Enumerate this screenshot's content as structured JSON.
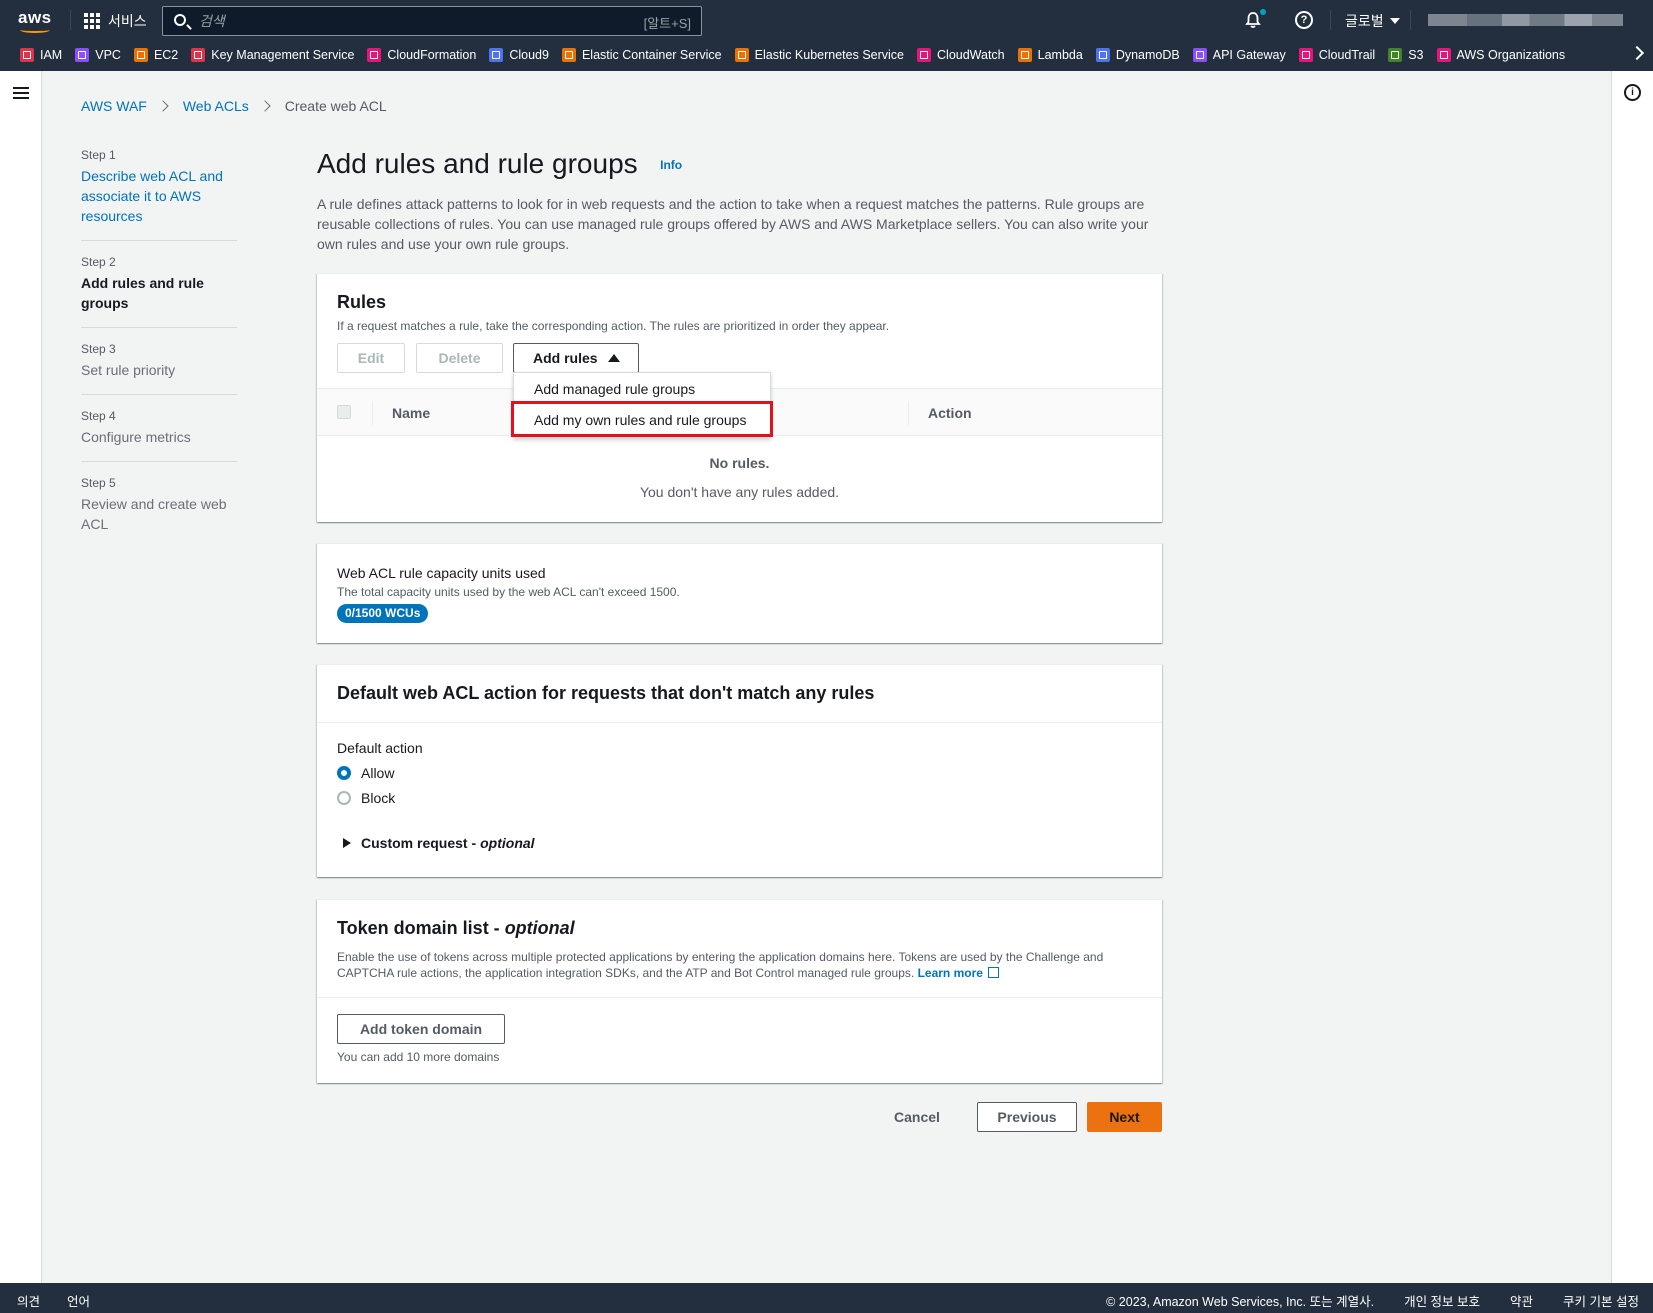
{
  "topnav": {
    "logo_text": "aws",
    "services_label": "서비스",
    "search_placeholder": "검색",
    "search_shortcut": "[알트+S]",
    "help_symbol": "?",
    "region_label": "글로벌",
    "favorites": [
      {
        "label": "IAM",
        "color": "#dd344c"
      },
      {
        "label": "VPC",
        "color": "#8c4fff"
      },
      {
        "label": "EC2",
        "color": "#ed7100"
      },
      {
        "label": "Key Management Service",
        "color": "#dd344c"
      },
      {
        "label": "CloudFormation",
        "color": "#e7157b"
      },
      {
        "label": "Cloud9",
        "color": "#4d72f3"
      },
      {
        "label": "Elastic Container Service",
        "color": "#ed7100"
      },
      {
        "label": "Elastic Kubernetes Service",
        "color": "#ed7100"
      },
      {
        "label": "CloudWatch",
        "color": "#e7157b"
      },
      {
        "label": "Lambda",
        "color": "#ed7100"
      },
      {
        "label": "DynamoDB",
        "color": "#4d72f3"
      },
      {
        "label": "API Gateway",
        "color": "#8c4fff"
      },
      {
        "label": "CloudTrail",
        "color": "#e7157b"
      },
      {
        "label": "S3",
        "color": "#3f8624"
      },
      {
        "label": "AWS Organizations",
        "color": "#e7157b"
      }
    ]
  },
  "right_rail": {
    "info_symbol": "i"
  },
  "breadcrumb": {
    "items": [
      "AWS WAF",
      "Web ACLs"
    ],
    "current": "Create web ACL"
  },
  "steps": [
    {
      "num": "Step 1",
      "title": "Describe web ACL and associate it to AWS resources",
      "state": "link"
    },
    {
      "num": "Step 2",
      "title": "Add rules and rule groups",
      "state": "active"
    },
    {
      "num": "Step 3",
      "title": "Set rule priority",
      "state": "disabled"
    },
    {
      "num": "Step 4",
      "title": "Configure metrics",
      "state": "disabled"
    },
    {
      "num": "Step 5",
      "title": "Review and create web ACL",
      "state": "disabled"
    }
  ],
  "main": {
    "title": "Add rules and rule groups",
    "info_link": "Info",
    "description": "A rule defines attack patterns to look for in web requests and the action to take when a request matches the patterns. Rule groups are reusable collections of rules. You can use managed rule groups offered by AWS and AWS Marketplace sellers. You can also write your own rules and use your own rule groups."
  },
  "rules": {
    "title": "Rules",
    "subtitle": "If a request matches a rule, take the corresponding action. The rules are prioritized in order they appear.",
    "edit_label": "Edit",
    "delete_label": "Delete",
    "add_rules_label": "Add rules",
    "col_name": "Name",
    "col_action": "Action",
    "empty_title": "No rules.",
    "empty_sub": "You don't have any rules added.",
    "dropdown": [
      "Add managed rule groups",
      "Add my own rules and rule groups"
    ]
  },
  "wcu": {
    "title": "Web ACL rule capacity units used",
    "subtitle": "The total capacity units used by the web ACL can't exceed 1500.",
    "badge": "0/1500 WCUs"
  },
  "default_action": {
    "title": "Default web ACL action for requests that don't match any rules",
    "label": "Default action",
    "options": [
      "Allow",
      "Block"
    ],
    "selected": "Allow",
    "custom_request": "Custom request - ",
    "custom_request_optional": "optional"
  },
  "token": {
    "title": "Token domain list - ",
    "title_optional": "optional",
    "description": "Enable the use of tokens across multiple protected applications by entering the application domains here. Tokens are used by the Challenge and CAPTCHA rule actions, the application integration SDKs, and the ATP and Bot Control managed rule groups.",
    "learn_more": "Learn more",
    "add_button": "Add token domain",
    "note": "You can add 10 more domains"
  },
  "footer": {
    "cancel": "Cancel",
    "previous": "Previous",
    "next": "Next"
  },
  "bottom": {
    "feedback": "의견",
    "language": "언어",
    "copyright": "© 2023, Amazon Web Services, Inc. 또는 계열사.",
    "privacy": "개인 정보 보호",
    "terms": "약관",
    "cookies": "쿠키 기본 설정"
  }
}
